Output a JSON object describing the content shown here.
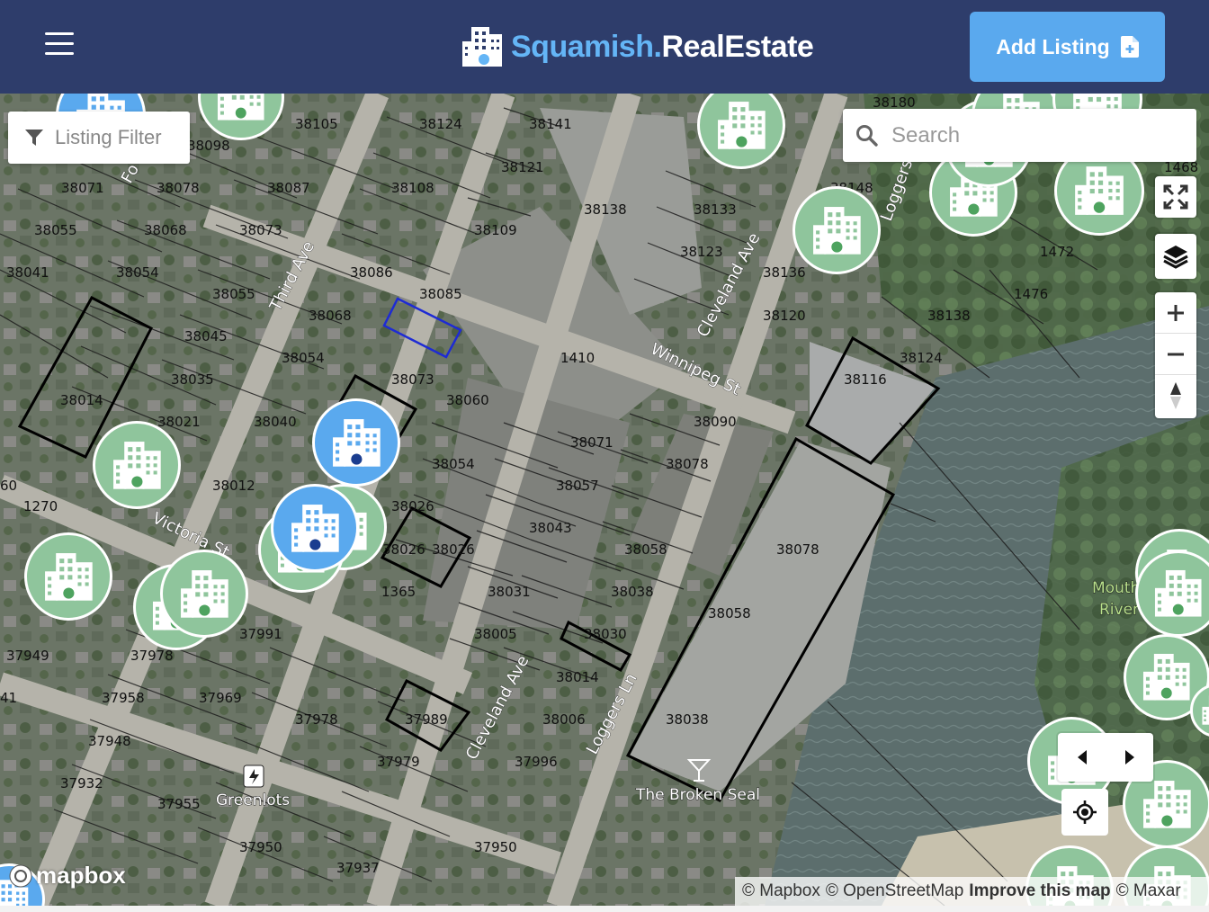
{
  "header": {
    "brand_main": "Squamish",
    "brand_dot": ".",
    "brand_real": "Real",
    "brand_estate": "Estate",
    "add_listing_label": "Add Listing"
  },
  "map": {
    "filter_label": "Listing Filter",
    "search_placeholder": "Search",
    "mapbox_logo_text": "mapbox",
    "attribution": {
      "mapbox": "© Mapbox",
      "osm": "© OpenStreetMap",
      "improve": "Improve this map",
      "maxar": "© Maxar"
    },
    "streets": [
      "Third Ave",
      "Cleveland Ave",
      "Winnipeg St",
      "Victoria St",
      "Loggers Ln",
      "Cleveland Ave",
      "Loggers Ln",
      "Fo"
    ],
    "pois": [
      "Greenlots",
      "The Broken Seal",
      "Mouth",
      "River"
    ],
    "lot_numbers": [
      "38105",
      "38124",
      "38141",
      "38098",
      "38071",
      "38078",
      "38087",
      "38108",
      "38121",
      "38138",
      "38133",
      "38055",
      "38068",
      "38073",
      "38109",
      "38123",
      "38041",
      "38054",
      "38086",
      "38085",
      "38136",
      "38055",
      "38068",
      "38120",
      "38045",
      "38054",
      "38073",
      "1410",
      "38014",
      "38035",
      "38060",
      "38021",
      "38040",
      "38071",
      "38090",
      "38054",
      "38078",
      "38012",
      "38026",
      "38057",
      "1270",
      "38043",
      "38026",
      "38026",
      "38058",
      "38078",
      "1365",
      "38031",
      "38038",
      "38058",
      "37991",
      "38005",
      "38030",
      "37949",
      "37978",
      "38014",
      "37958",
      "37969",
      "37978",
      "37989",
      "38006",
      "38038",
      "37948",
      "37979",
      "37996",
      "37932",
      "37955",
      "37950",
      "37950",
      "37937",
      "38180",
      "38148",
      "1472",
      "1476",
      "38138",
      "38124",
      "38116",
      "1468"
    ]
  }
}
